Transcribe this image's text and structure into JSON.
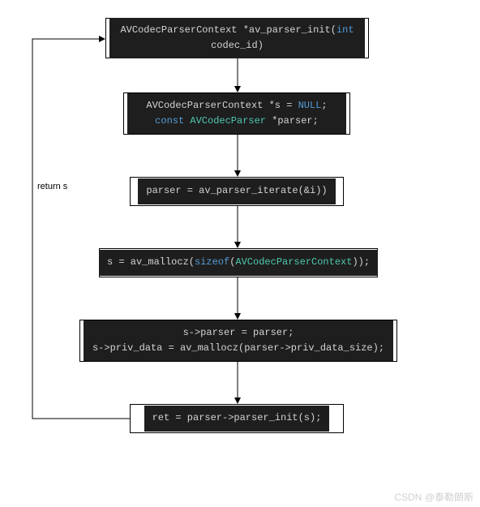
{
  "diagram": {
    "nodes": {
      "n1": {
        "line1_pre": "AVCodecParserContext *av_parser_init(",
        "line1_kw": "int",
        "line2": "codec_id)"
      },
      "n2": {
        "line1_pre": "AVCodecParserContext *s = ",
        "line1_kw": "NULL",
        "line1_post": ";",
        "line2_kw1": "const",
        "line2_mid": " ",
        "line2_kw2": "AVCodecParser",
        "line2_post": " *parser;"
      },
      "n3": {
        "line1": "parser = av_parser_iterate(&i))"
      },
      "n4": {
        "line1_pre": "s = av_mallocz(",
        "line1_kw1": "sizeof",
        "line1_mid": "(",
        "line1_kw2": "AVCodecParserContext",
        "line1_post": "));"
      },
      "n5": {
        "line1": "s->parser = parser;",
        "line2": "s->priv_data = av_mallocz(parser->priv_data_size);"
      },
      "n6": {
        "line1": "ret = parser->parser_init(s);"
      }
    },
    "edge_label": "return s",
    "watermark": "CSDN @泰勒朗斯"
  }
}
